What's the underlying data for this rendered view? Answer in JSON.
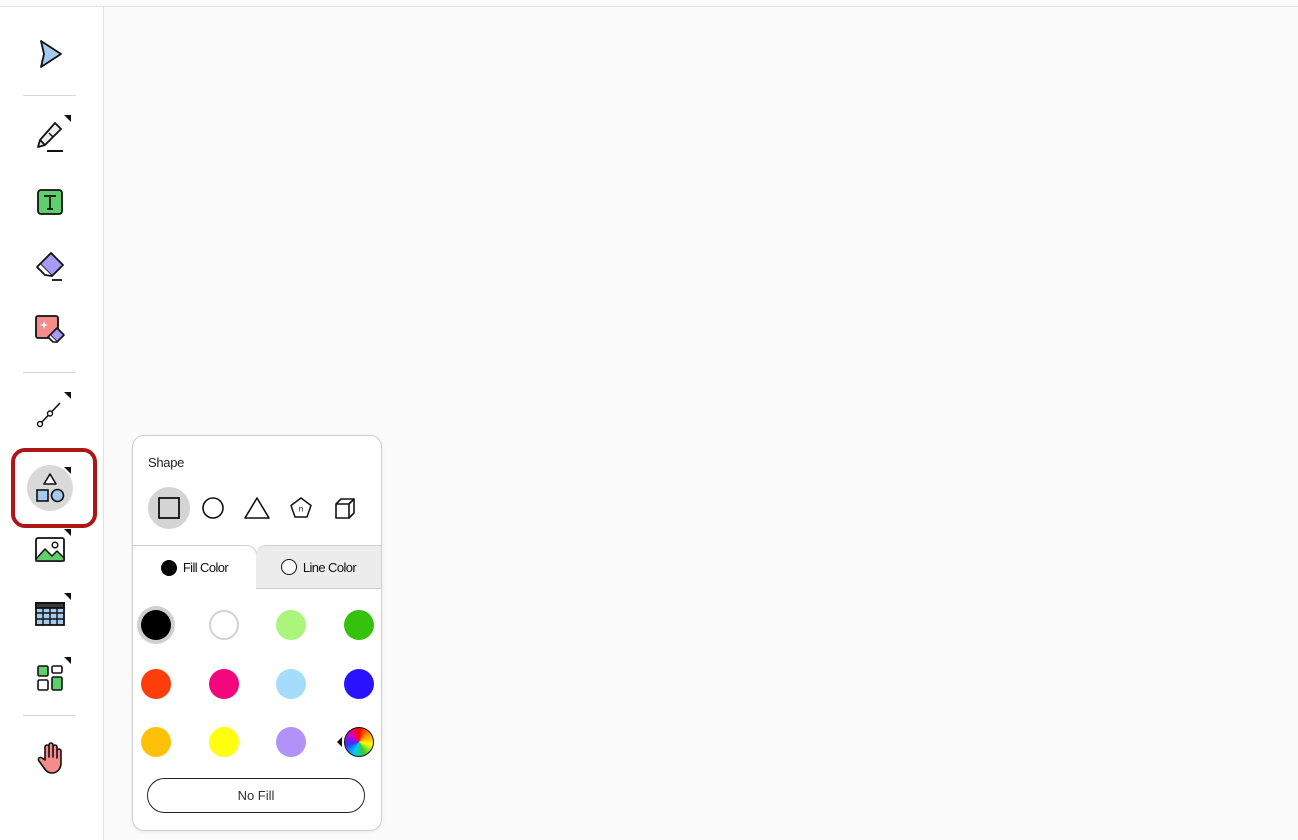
{
  "toolbar": {
    "tools": [
      "select",
      "pen",
      "text",
      "eraser",
      "magic-eraser",
      "line",
      "shape",
      "image",
      "table",
      "layout",
      "hand"
    ]
  },
  "shape_popup": {
    "title": "Shape",
    "shapes": [
      "square",
      "circle",
      "triangle",
      "pentagon",
      "cube"
    ],
    "selected_shape": "square",
    "tabs": {
      "fill_label": "Fill Color",
      "line_label": "Line Color"
    },
    "active_tab": "fill",
    "colors": [
      "#000000",
      "#ffffff",
      "#abf57c",
      "#35c20c",
      "#ff3d0a",
      "#f4077c",
      "#a6dcfb",
      "#2a14ff",
      "#ffc107",
      "#ffff0f",
      "#b092f8",
      "rainbow"
    ],
    "selected_color": "#000000",
    "no_fill_label": "No Fill"
  },
  "accent": {
    "highlight": "#b01515"
  }
}
